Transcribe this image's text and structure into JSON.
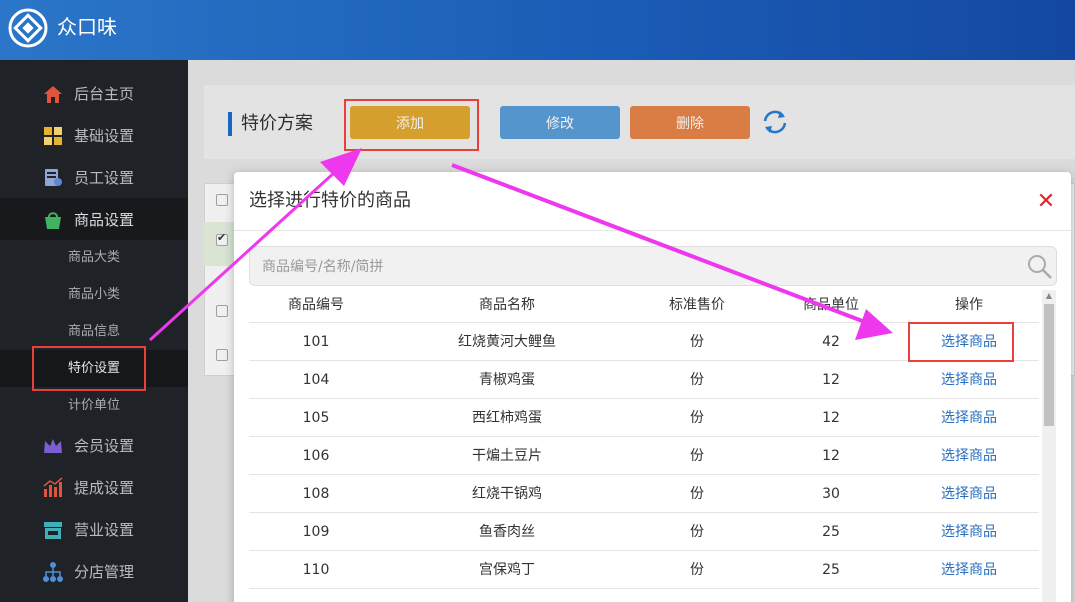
{
  "app": {
    "title": "众口味"
  },
  "sidebar": {
    "items": [
      {
        "label": "后台主页",
        "icon": "home-icon"
      },
      {
        "label": "基础设置",
        "icon": "grid-icon"
      },
      {
        "label": "员工设置",
        "icon": "staff-icon"
      },
      {
        "label": "商品设置",
        "icon": "bag-icon"
      },
      {
        "label": "会员设置",
        "icon": "crown-icon"
      },
      {
        "label": "提成设置",
        "icon": "chart-icon"
      },
      {
        "label": "营业设置",
        "icon": "store-icon"
      },
      {
        "label": "分店管理",
        "icon": "sitemap-icon"
      }
    ],
    "sub_items": [
      {
        "label": "商品大类"
      },
      {
        "label": "商品小类"
      },
      {
        "label": "商品信息"
      },
      {
        "label": "特价设置"
      },
      {
        "label": "计价单位"
      }
    ]
  },
  "page": {
    "title": "特价方案",
    "add_label": "添加",
    "edit_label": "修改",
    "delete_label": "删除"
  },
  "modal": {
    "title": "选择进行特价的商品",
    "close": "✕",
    "search_placeholder": "商品编号/名称/简拼",
    "columns": [
      "商品编号",
      "商品名称",
      "标准售价",
      "商品单位",
      "操作"
    ],
    "rows": [
      {
        "code": "101",
        "name": "红烧黄河大鲤鱼",
        "price": "份",
        "unit": "42",
        "action": "选择商品"
      },
      {
        "code": "104",
        "name": "青椒鸡蛋",
        "price": "份",
        "unit": "12",
        "action": "选择商品"
      },
      {
        "code": "105",
        "name": "西红柿鸡蛋",
        "price": "份",
        "unit": "12",
        "action": "选择商品"
      },
      {
        "code": "106",
        "name": "干煸土豆片",
        "price": "份",
        "unit": "12",
        "action": "选择商品"
      },
      {
        "code": "108",
        "name": "红烧干锅鸡",
        "price": "份",
        "unit": "30",
        "action": "选择商品"
      },
      {
        "code": "109",
        "name": "鱼香肉丝",
        "price": "份",
        "unit": "25",
        "action": "选择商品"
      },
      {
        "code": "110",
        "name": "宫保鸡丁",
        "price": "份",
        "unit": "25",
        "action": "选择商品"
      }
    ]
  },
  "colors": {
    "header": "#1a5bb5",
    "sidebar": "#1f2227",
    "add_button": "#e2a930",
    "edit_button": "#5b9fdb",
    "delete_button": "#e7854a",
    "highlight": "#e8403a",
    "annotation_arrow": "#ee38ee",
    "link": "#2a6fbd"
  }
}
